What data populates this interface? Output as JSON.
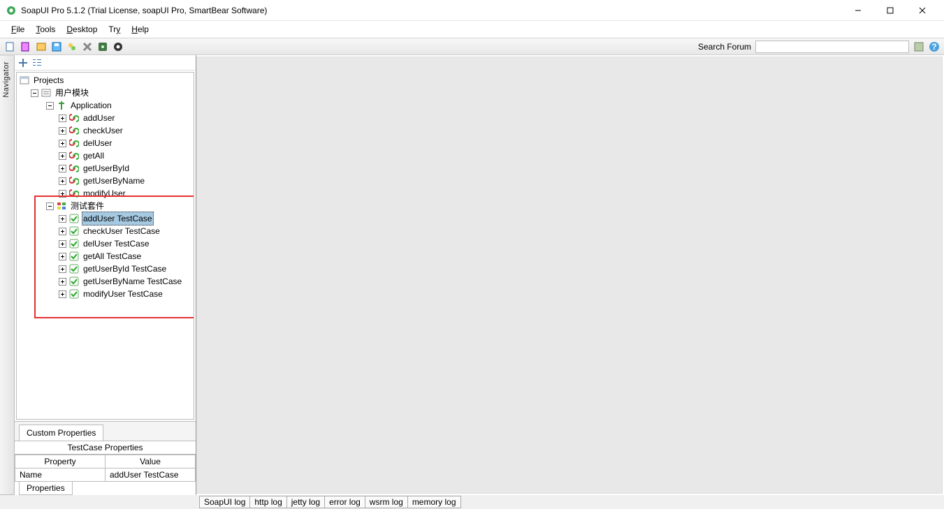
{
  "window": {
    "title": "SoapUI Pro 5.1.2 (Trial License, soapUI Pro, SmartBear Software)"
  },
  "menu": {
    "items": [
      "File",
      "Tools",
      "Desktop",
      "Try",
      "Help"
    ]
  },
  "toolbar": {
    "search_label": "Search Forum",
    "search_value": ""
  },
  "navigator": {
    "tab_label": "Navigator",
    "root": "Projects",
    "project": "用户模块",
    "interface": "Application",
    "operations": [
      "addUser",
      "checkUser",
      "delUser",
      "getAll",
      "getUserById",
      "getUserByName",
      "modifyUser"
    ],
    "suite": "测试套件",
    "testcases": [
      "addUser TestCase",
      "checkUser TestCase",
      "delUser TestCase",
      "getAll TestCase",
      "getUserById TestCase",
      "getUserByName TestCase",
      "modifyUser TestCase"
    ],
    "selected_testcase_index": 0
  },
  "properties": {
    "tab_custom": "Custom Properties",
    "panel_title": "TestCase Properties",
    "col_property": "Property",
    "col_value": "Value",
    "rows": [
      {
        "property": "Name",
        "value": "addUser TestCase"
      }
    ],
    "bottom_tab": "Properties"
  },
  "logs": [
    "SoapUI log",
    "http log",
    "jetty log",
    "error log",
    "wsrm log",
    "memory log"
  ]
}
